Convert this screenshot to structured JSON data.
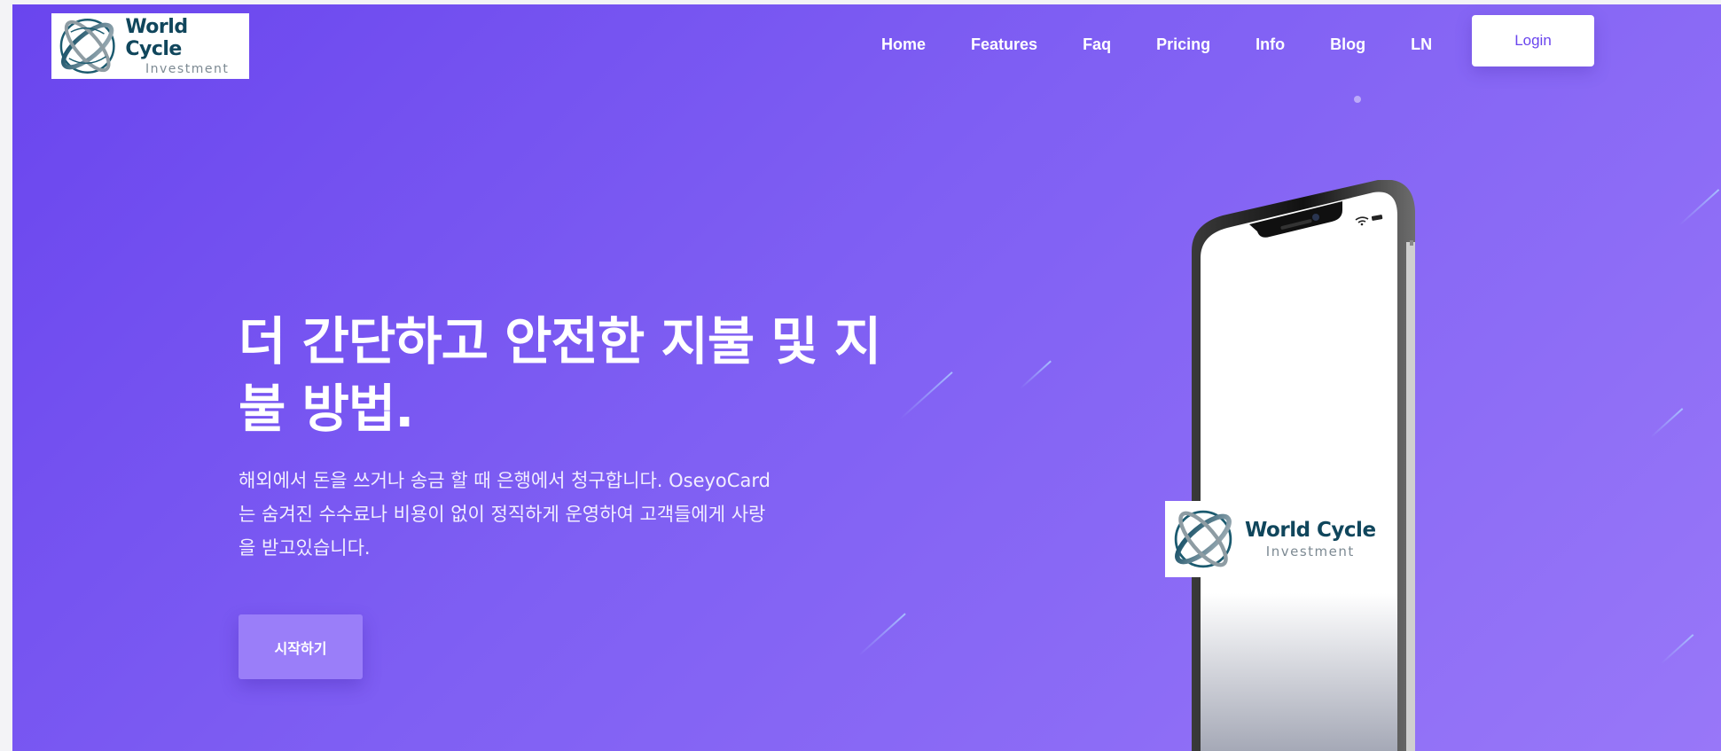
{
  "brand": {
    "name": "World Cycle",
    "tagline": "Investment"
  },
  "nav": {
    "items": [
      "Home",
      "Features",
      "Faq",
      "Pricing",
      "Info",
      "Blog",
      "LN"
    ],
    "login_label": "Login"
  },
  "hero": {
    "headline_line1": "더 간단하고 안전한 지불 및 지",
    "headline_line2": "불 방법.",
    "description_line1": "해외에서 돈을 쓰거나 송금 할 때 은행에서 청구합니다. OseyoCard",
    "description_line2": "는 숨겨진 수수료나 비용이 없이 정직하게 운영하여 고객들에게 사랑",
    "description_line3": "을 받고있습니다.",
    "cta_label": "시작하기"
  },
  "phone_screen": {
    "brand_name": "World Cycle",
    "brand_tagline": "Investment"
  },
  "colors": {
    "accent": "#6a45ee",
    "gradient_end": "#9877f8",
    "cta_bg": "#9a7ef9",
    "brand_text": "#10465c"
  },
  "icons": [
    "globe-orbit-logo-icon",
    "wifi-icon",
    "battery-icon"
  ]
}
